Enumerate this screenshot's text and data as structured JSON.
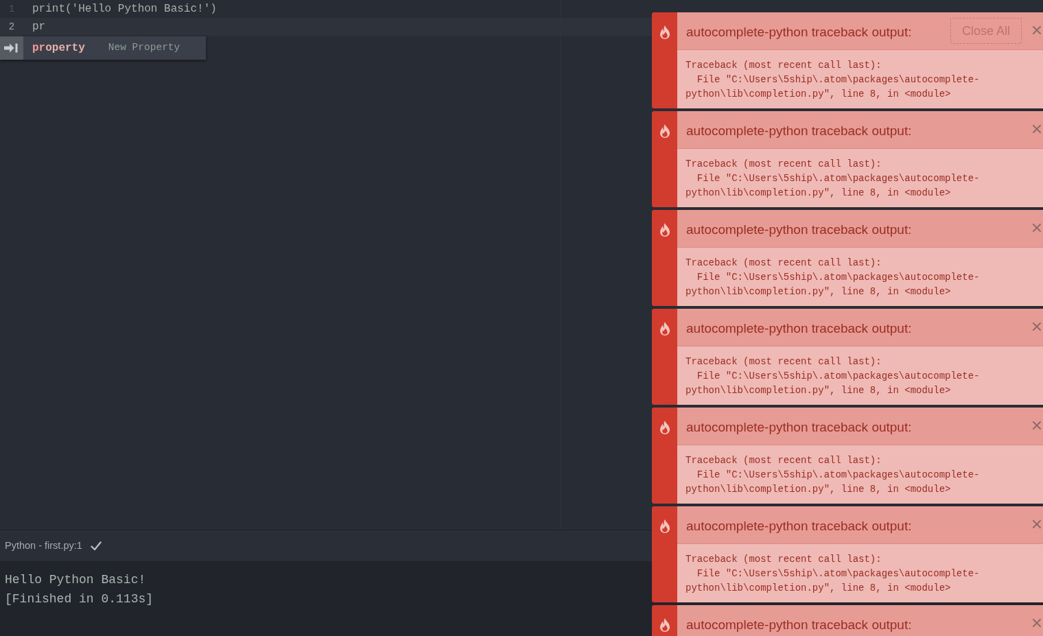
{
  "editor": {
    "lines": [
      {
        "number": "1",
        "code": "print('Hello Python Basic!')",
        "active": false
      },
      {
        "number": "2",
        "code": "pr",
        "active": true
      }
    ],
    "autocomplete": {
      "suggestions": [
        {
          "text": "**pr**operty",
          "description": "New Property",
          "selected": true
        }
      ]
    }
  },
  "status_bar": {
    "label": "Python - first.py:1"
  },
  "output": {
    "lines": [
      "Hello Python Basic!",
      "[Finished in 0.113s]"
    ]
  },
  "notifications": [
    {
      "title": "autocomplete-python traceback output:",
      "close_all": "Close All",
      "traceback": "Traceback (most recent call last):\n  File \"C:\\Users\\5ship\\.atom\\packages\\autocomplete-python\\lib\\completion.py\", line 8, in <module>"
    },
    {
      "title": "autocomplete-python traceback output:",
      "traceback": "Traceback (most recent call last):\n  File \"C:\\Users\\5ship\\.atom\\packages\\autocomplete-python\\lib\\completion.py\", line 8, in <module>"
    },
    {
      "title": "autocomplete-python traceback output:",
      "traceback": "Traceback (most recent call last):\n  File \"C:\\Users\\5ship\\.atom\\packages\\autocomplete-python\\lib\\completion.py\", line 8, in <module>"
    },
    {
      "title": "autocomplete-python traceback output:",
      "traceback": "Traceback (most recent call last):\n  File \"C:\\Users\\5ship\\.atom\\packages\\autocomplete-python\\lib\\completion.py\", line 8, in <module>"
    },
    {
      "title": "autocomplete-python traceback output:",
      "traceback": "Traceback (most recent call last):\n  File \"C:\\Users\\5ship\\.atom\\packages\\autocomplete-python\\lib\\completion.py\", line 8, in <module>"
    },
    {
      "title": "autocomplete-python traceback output:",
      "traceback": "Traceback (most recent call last):\n  File \"C:\\Users\\5ship\\.atom\\packages\\autocomplete-python\\lib\\completion.py\", line 8, in <module>"
    },
    {
      "title": "autocomplete-python traceback output:"
    }
  ]
}
